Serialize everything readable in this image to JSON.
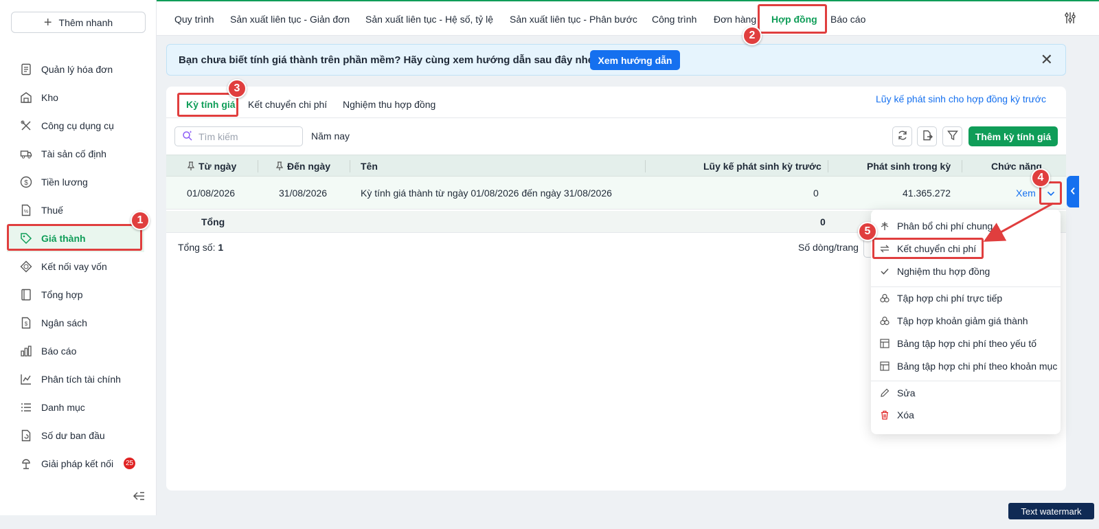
{
  "sidebar": {
    "quick_add": "Thêm nhanh",
    "items": [
      {
        "label": "Quản lý hóa đơn",
        "icon": "invoice-icon"
      },
      {
        "label": "Kho",
        "icon": "warehouse-icon"
      },
      {
        "label": "Công cụ dụng cụ",
        "icon": "tools-icon"
      },
      {
        "label": "Tài sản cố định",
        "icon": "truck-icon"
      },
      {
        "label": "Tiền lương",
        "icon": "dollar-icon"
      },
      {
        "label": "Thuế",
        "icon": "tax-icon"
      },
      {
        "label": "Giá thành",
        "icon": "tag-icon",
        "active": true
      },
      {
        "label": "Kết nối vay vốn",
        "icon": "loan-icon"
      },
      {
        "label": "Tổng hợp",
        "icon": "book-icon"
      },
      {
        "label": "Ngân sách",
        "icon": "budget-icon"
      },
      {
        "label": "Báo cáo",
        "icon": "bar-chart-icon"
      },
      {
        "label": "Phân tích tài chính",
        "icon": "analytics-icon"
      },
      {
        "label": "Danh mục",
        "icon": "list-icon"
      },
      {
        "label": "Số dư ban đầu",
        "icon": "balance-icon"
      },
      {
        "label": "Giải pháp kết nối",
        "icon": "connect-icon"
      }
    ],
    "connect_badge": "25"
  },
  "topnav": {
    "tabs": [
      "Quy trình",
      "Sản xuất liên tục - Giản đơn",
      "Sản xuất liên tục - Hệ số, tỷ lệ",
      "Sản xuất liên tục - Phân bước",
      "Công trình",
      "Đơn hàng",
      "Hợp đồng",
      "Báo cáo"
    ],
    "active_tab": "Hợp đồng"
  },
  "banner": {
    "text": "Bạn chưa biết tính giá thành trên phần mềm? Hãy cùng xem hướng dẫn sau đây nhé!",
    "button": "Xem hướng dẫn"
  },
  "subtabs": {
    "items": [
      "Kỳ tính giá",
      "Kết chuyển chi phí",
      "Nghiệm thu hợp đồng"
    ],
    "link": "Lũy kế phát sinh cho hợp đồng kỳ trước"
  },
  "toolbar": {
    "search_placeholder": "Tìm kiếm",
    "year_filter": "Năm nay",
    "add_button": "Thêm kỳ tính giá"
  },
  "table": {
    "headers": [
      "Từ ngày",
      "Đến ngày",
      "Tên",
      "Lũy kế phát sinh kỳ trước",
      "Phát sinh trong kỳ",
      "Chức năng"
    ],
    "rows": [
      {
        "from": "01/08/2026",
        "to": "31/08/2026",
        "name": "Kỳ tính giá thành từ ngày 01/08/2026 đến ngày 31/08/2026",
        "prev": "0",
        "current": "41.365.272",
        "action": "Xem"
      }
    ],
    "footer": {
      "label": "Tổng",
      "prev": "0"
    },
    "total_label": "Tổng số:",
    "total_value": "1",
    "page_size_label": "Số dòng/trang"
  },
  "menu": {
    "items": [
      {
        "label": "Phân bổ chi phí chung",
        "icon": "allocate-icon"
      },
      {
        "label": "Kết chuyển chi phí",
        "icon": "transfer-icon"
      },
      {
        "label": "Nghiệm thu hợp đồng",
        "icon": "check-icon"
      },
      {
        "label": "Tập hợp chi phí trực tiếp",
        "icon": "group-icon"
      },
      {
        "label": "Tập hợp khoản giảm giá thành",
        "icon": "group-icon"
      },
      {
        "label": "Bảng tập hợp chi phí theo yếu tố",
        "icon": "table-icon"
      },
      {
        "label": "Bảng tập hợp chi phí theo khoản mục",
        "icon": "table-icon"
      },
      {
        "label": "Sửa",
        "icon": "edit-icon"
      },
      {
        "label": "Xóa",
        "icon": "trash-icon"
      }
    ]
  },
  "annotations": {
    "steps": [
      "1",
      "2",
      "3",
      "4",
      "5"
    ]
  },
  "watermark": "Text watermark",
  "colors": {
    "primary_green": "#0f9d58",
    "link_blue": "#1570ef",
    "annotation_red": "#e03e3e"
  }
}
